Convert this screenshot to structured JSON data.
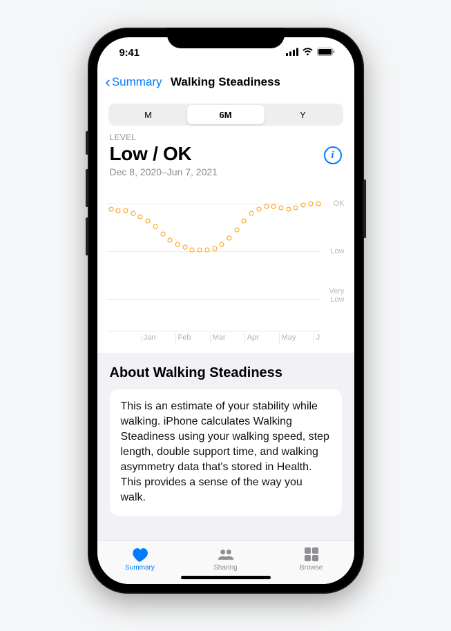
{
  "status": {
    "time": "9:41"
  },
  "nav": {
    "back": "Summary",
    "title": "Walking Steadiness"
  },
  "segments": {
    "m": "M",
    "sm": "6M",
    "y": "Y"
  },
  "level": {
    "label": "LEVEL",
    "value": "Low / OK",
    "range": "Dec 8, 2020–Jun 7, 2021"
  },
  "chart_data": {
    "type": "scatter",
    "y_levels": [
      "OK",
      "Low",
      "Very Low"
    ],
    "x_ticks": [
      "",
      "Jan",
      "Feb",
      "Mar",
      "Apr",
      "May",
      "J"
    ],
    "series": [
      {
        "name": "Walking Steadiness",
        "color": "#ff9500",
        "points": [
          {
            "x": 0.02,
            "y": 0.83
          },
          {
            "x": 0.055,
            "y": 0.82
          },
          {
            "x": 0.09,
            "y": 0.82
          },
          {
            "x": 0.125,
            "y": 0.8
          },
          {
            "x": 0.16,
            "y": 0.78
          },
          {
            "x": 0.195,
            "y": 0.75
          },
          {
            "x": 0.23,
            "y": 0.71
          },
          {
            "x": 0.265,
            "y": 0.66
          },
          {
            "x": 0.3,
            "y": 0.62
          },
          {
            "x": 0.335,
            "y": 0.59
          },
          {
            "x": 0.37,
            "y": 0.57
          },
          {
            "x": 0.405,
            "y": 0.55
          },
          {
            "x": 0.44,
            "y": 0.55
          },
          {
            "x": 0.475,
            "y": 0.55
          },
          {
            "x": 0.51,
            "y": 0.56
          },
          {
            "x": 0.545,
            "y": 0.59
          },
          {
            "x": 0.58,
            "y": 0.63
          },
          {
            "x": 0.615,
            "y": 0.69
          },
          {
            "x": 0.65,
            "y": 0.75
          },
          {
            "x": 0.685,
            "y": 0.8
          },
          {
            "x": 0.72,
            "y": 0.83
          },
          {
            "x": 0.755,
            "y": 0.85
          },
          {
            "x": 0.79,
            "y": 0.85
          },
          {
            "x": 0.825,
            "y": 0.84
          },
          {
            "x": 0.86,
            "y": 0.83
          },
          {
            "x": 0.895,
            "y": 0.84
          },
          {
            "x": 0.93,
            "y": 0.86
          },
          {
            "x": 0.965,
            "y": 0.87
          },
          {
            "x": 1.0,
            "y": 0.87
          }
        ]
      }
    ]
  },
  "about": {
    "title": "About Walking Steadiness",
    "body": "This is an estimate of your stability while walking. iPhone calculates Walking Steadiness using your walking speed, step length, double support time, and walking asymmetry data that's stored in Health. This provides a sense of the way you walk."
  },
  "tabs": {
    "summary": "Summary",
    "sharing": "Sharing",
    "browse": "Browse"
  }
}
